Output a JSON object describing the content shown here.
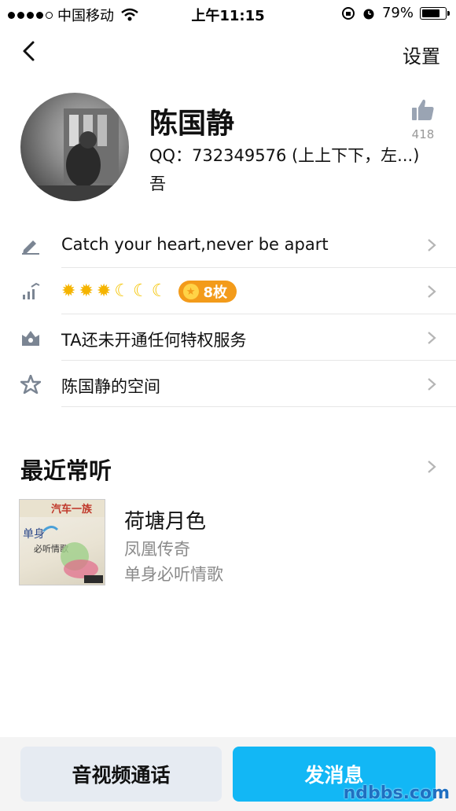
{
  "status_bar": {
    "carrier": "中国移动",
    "time": "上午11:15",
    "battery": "79%"
  },
  "nav": {
    "settings_label": "设置"
  },
  "profile": {
    "name": "陈国静",
    "qq": "QQ：732349576 (上上下下，左...)",
    "subline": "吾",
    "likes": "418"
  },
  "rows": {
    "signature": "Catch your heart,never be apart",
    "level_badge": "8枚",
    "privilege": "TA还未开通任何特权服务",
    "space": "陈国静的空间"
  },
  "recent": {
    "title": "最近常听",
    "song": {
      "name": "荷塘月色",
      "artist": "凤凰传奇",
      "album": "单身必听情歌",
      "cover_text_1": "汽车一族",
      "cover_text_2": "单身",
      "cover_text_3": "必听情歌"
    }
  },
  "buttons": {
    "call": "音视频通话",
    "message": "发消息"
  },
  "watermark": "ndbbs.com",
  "colors": {
    "accent": "#12b7f5",
    "badge": "#f39b1a",
    "sun": "#f5b400",
    "muted": "#8a8a8a"
  }
}
